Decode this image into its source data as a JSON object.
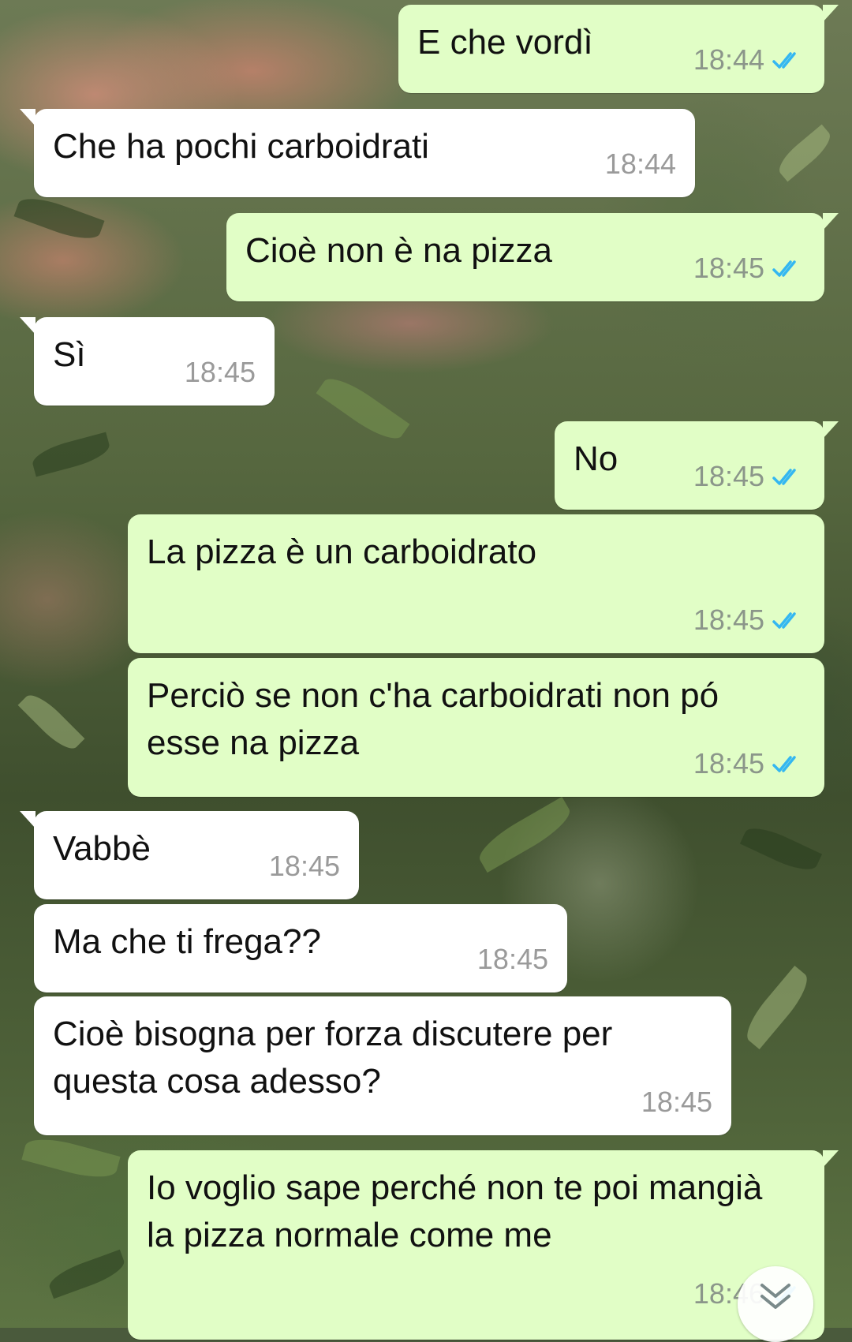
{
  "chat": {
    "messages": [
      {
        "direction": "outgoing",
        "text": "E che vordì",
        "time": "18:44",
        "status": "read"
      },
      {
        "direction": "incoming",
        "text": "Che ha pochi carboidrati",
        "time": "18:44"
      },
      {
        "direction": "outgoing",
        "text": "Cioè non è na pizza",
        "time": "18:45",
        "status": "read"
      },
      {
        "direction": "incoming",
        "text": "Sì",
        "time": "18:45"
      },
      {
        "direction": "outgoing",
        "text": "No",
        "time": "18:45",
        "status": "read"
      },
      {
        "direction": "outgoing",
        "text": "La pizza è un carboidrato",
        "time": "18:45",
        "status": "read"
      },
      {
        "direction": "outgoing",
        "text": "Perciò se non c'ha carboidrati non pó esse na pizza",
        "time": "18:45",
        "status": "read"
      },
      {
        "direction": "incoming",
        "text": "Vabbè",
        "time": "18:45"
      },
      {
        "direction": "incoming",
        "text": "Ma che ti frega??",
        "time": "18:45"
      },
      {
        "direction": "incoming",
        "text": "Cioè bisogna per forza discutere per questa cosa adesso?",
        "time": "18:45"
      },
      {
        "direction": "outgoing",
        "text": "Io voglio sape perché non te poi mangià la pizza normale come me",
        "time": "18:46",
        "status": "read"
      }
    ]
  },
  "colors": {
    "outgoing_bubble": "#e1fec6",
    "incoming_bubble": "#ffffff",
    "read_ticks": "#34b7f1",
    "timestamp": "#8b968a"
  },
  "icons": {
    "read_receipt": "double-check-icon",
    "scroll_down": "double-chevron-down-icon"
  }
}
